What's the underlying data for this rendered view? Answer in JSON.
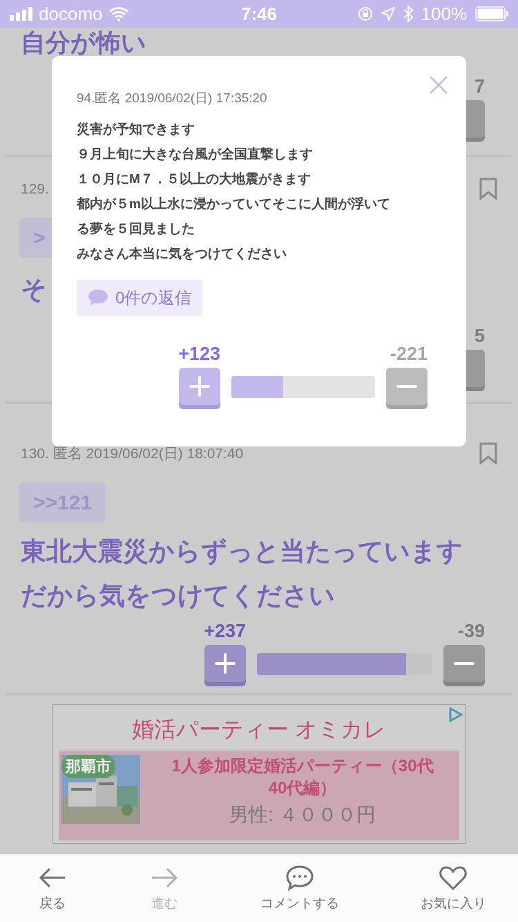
{
  "status_bar": {
    "carrier": "docomo",
    "time": "7:46",
    "battery": "100%"
  },
  "thread": {
    "title": "自分が怖い",
    "first_post": {
      "minus_count": "7"
    },
    "post_129": {
      "header": "129.",
      "quote": ">",
      "body": "そ",
      "minus_count": "5"
    },
    "post_130": {
      "header": "130. 匿名 2019/06/02(日) 18:07:40",
      "quote": ">>121",
      "body_lines": [
        "東北大震災からずっと当たっています",
        "だから気をつけてください"
      ],
      "votes": {
        "plus": "+237",
        "minus": "-39",
        "level": 0.85
      }
    }
  },
  "ad": {
    "logo": "婚活パーティー オミカレ",
    "items": [
      {
        "city": "那覇市",
        "title_lines": [
          "1人参加限定婚活パーティー（30代",
          "40代編）"
        ],
        "price": "男性: ４０００円"
      }
    ]
  },
  "modal": {
    "header": "94.匿名 2019/06/02(日) 17:35:20",
    "body_lines": [
      "災害が予知できます",
      "９月上旬に大きな台風が全国直撃します",
      "１０月にM７．５以上の大地震がきます",
      "都内が５m以上水に浸かっていてそこに人間が浮いて",
      "る夢を５回見ました",
      "みなさん本当に気をつけてください"
    ],
    "reply_button": "0件の返信",
    "votes": {
      "plus": "+123",
      "minus": "-221",
      "level": 0.36
    }
  },
  "bottom_nav": [
    {
      "kind": "back",
      "label": "戻る",
      "disabled": false
    },
    {
      "kind": "forward",
      "label": "進む",
      "disabled": true
    },
    {
      "kind": "comment",
      "label": "コメントする",
      "disabled": false
    },
    {
      "kind": "favorite",
      "label": "お気に入り",
      "disabled": false
    }
  ]
}
